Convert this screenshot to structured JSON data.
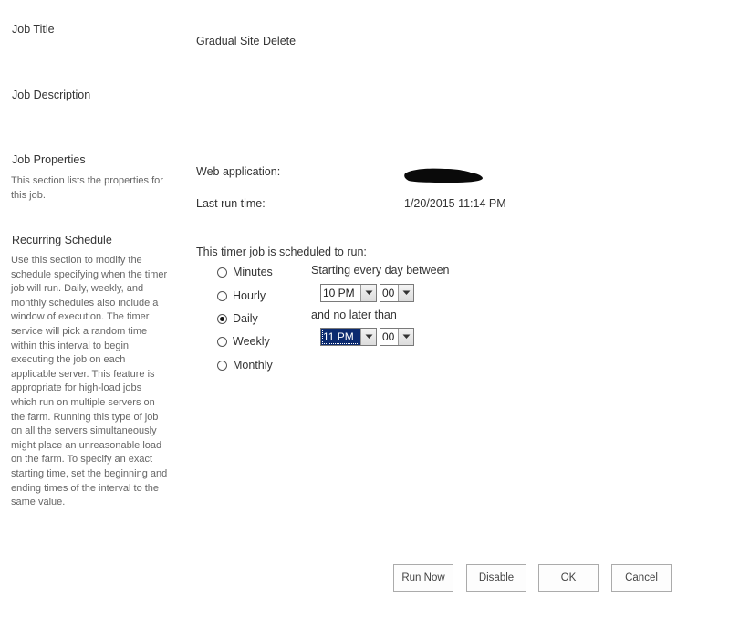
{
  "sections": {
    "job_title": {
      "title": "Job Title",
      "value": "Gradual Site Delete"
    },
    "job_description": {
      "title": "Job Description"
    },
    "job_properties": {
      "title": "Job Properties",
      "description": "This section lists the properties for this job.",
      "web_application_label": "Web application:",
      "last_run_label": "Last run time:",
      "last_run_value": "1/20/2015 11:14 PM"
    },
    "recurring_schedule": {
      "title": "Recurring Schedule",
      "description": "Use this section to modify the schedule specifying when the timer job will run. Daily, weekly, and monthly schedules also include a window of execution. The timer service will pick a random time within this interval to begin executing the job on each applicable server. This feature is appropriate for high-load jobs which run on multiple servers on the farm. Running this type of job on all the servers simultaneously might place an unreasonable load on the farm. To specify an exact starting time, set the beginning and ending times of the interval to the same value.",
      "scheduled_label": "This timer job is scheduled to run:",
      "options": [
        {
          "label": "Minutes",
          "checked": false
        },
        {
          "label": "Hourly",
          "checked": false
        },
        {
          "label": "Daily",
          "checked": true
        },
        {
          "label": "Weekly",
          "checked": false
        },
        {
          "label": "Monthly",
          "checked": false
        }
      ],
      "starting_label": "Starting every day between",
      "start_hour": "10 PM",
      "start_minute": "00",
      "no_later_label": "and no later than",
      "end_hour": "11 PM",
      "end_minute": "00"
    }
  },
  "buttons": {
    "run_now": "Run Now",
    "disable": "Disable",
    "ok": "OK",
    "cancel": "Cancel"
  }
}
